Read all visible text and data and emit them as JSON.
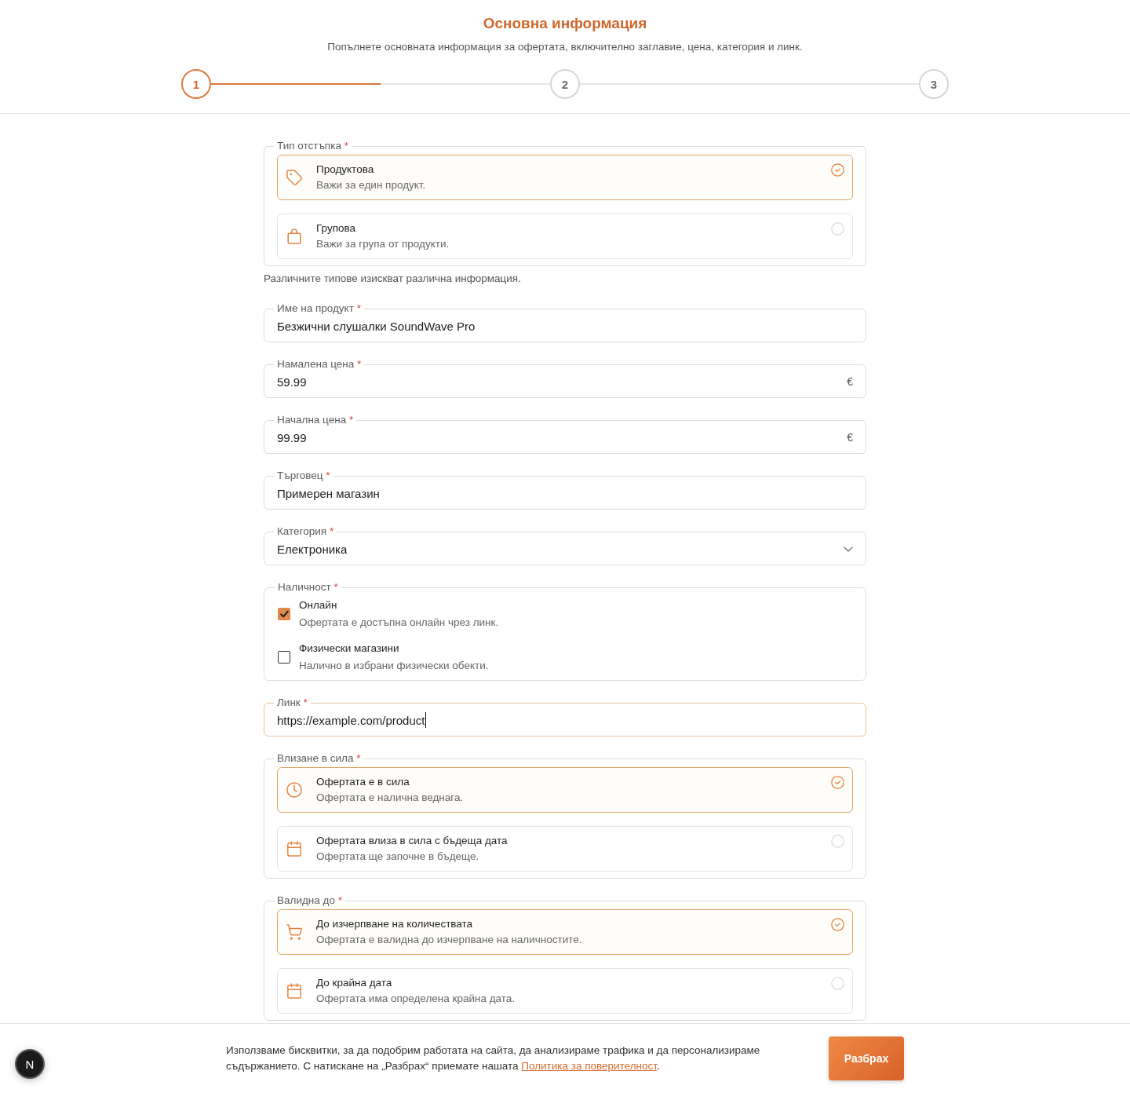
{
  "header": {
    "title": "Основна информация",
    "subtitle": "Попълнете основната информация за офертата, включително заглавие, цена, категория и линк."
  },
  "stepper": {
    "steps": [
      {
        "label": "1",
        "selected": true
      },
      {
        "label": "2",
        "selected": false
      },
      {
        "label": "3",
        "selected": false
      }
    ],
    "connectors": [
      {
        "level": 0.5
      }
    ]
  },
  "form": {
    "fields": [
      {
        "kind": "choice",
        "label": "Тип отстъпка",
        "required_mark": "*",
        "options": [
          {
            "title": "Продуктова",
            "description": "Важи за един продукт.",
            "selected": true
          },
          {
            "title": "Групова",
            "description": "Важи за група от продукти.",
            "selected": false
          }
        ],
        "hint": "Различните типове изискват различна информация."
      },
      {
        "kind": "text",
        "label": "Име на продукт",
        "required_mark": "*",
        "value": "Безжични слушалки SoundWave Pro",
        "focused": false
      },
      {
        "kind": "text",
        "label": "Намалена цена",
        "required_mark": "*",
        "value": "59.99",
        "suffix": "€",
        "focused": false
      },
      {
        "kind": "text",
        "label": "Начална цена",
        "required_mark": "*",
        "value": "99.99",
        "suffix": "€",
        "focused": false
      },
      {
        "kind": "text",
        "label": "Търговец",
        "required_mark": "*",
        "value": "Примерен магазин",
        "focused": false
      },
      {
        "kind": "select",
        "label": "Категория",
        "required_mark": "*",
        "value": "Електроника"
      },
      {
        "kind": "checks",
        "label": "Наличност",
        "required_mark": "*",
        "options": [
          {
            "title": "Онлайн",
            "description": "Офертата е достъпна онлайн чрез линк.",
            "checked": true
          },
          {
            "title": "Физически магазини",
            "description": "Налично в избрани физически обекти.",
            "checked": false
          }
        ]
      },
      {
        "kind": "text",
        "label": "Линк",
        "required_mark": "*",
        "value": "https://example.com/product",
        "focused": true
      },
      {
        "kind": "choice",
        "label": "Влизане в сила",
        "required_mark": "*",
        "options": [
          {
            "title": "Офертата е в сила",
            "description": "Офертата е налична веднага.",
            "selected": true
          },
          {
            "title": "Офертата влиза в сила с бъдеща дата",
            "description": "Офертата ще започне в бъдеще.",
            "selected": false
          }
        ]
      },
      {
        "kind": "choice",
        "label": "Валидна до",
        "required_mark": "*",
        "options": [
          {
            "title": "До изчерпване на количествата",
            "description": "Офертата е валидна до изчерпване на наличностите.",
            "selected": true
          },
          {
            "title": "До крайна дата",
            "description": "Офертата има определена крайна дата.",
            "selected": false
          }
        ]
      }
    ]
  },
  "cookie_banner": {
    "text": "Използваме бисквитки, за да подобрим работата на сайта, да анализираме трафика и да персонализираме съдържанието. С натискане на „Разбрах“ приемате нашата",
    "link": "Политика за поверителност",
    "text_end": ".",
    "button": "Разбрах"
  },
  "dev_badge": {
    "label": "N"
  }
}
